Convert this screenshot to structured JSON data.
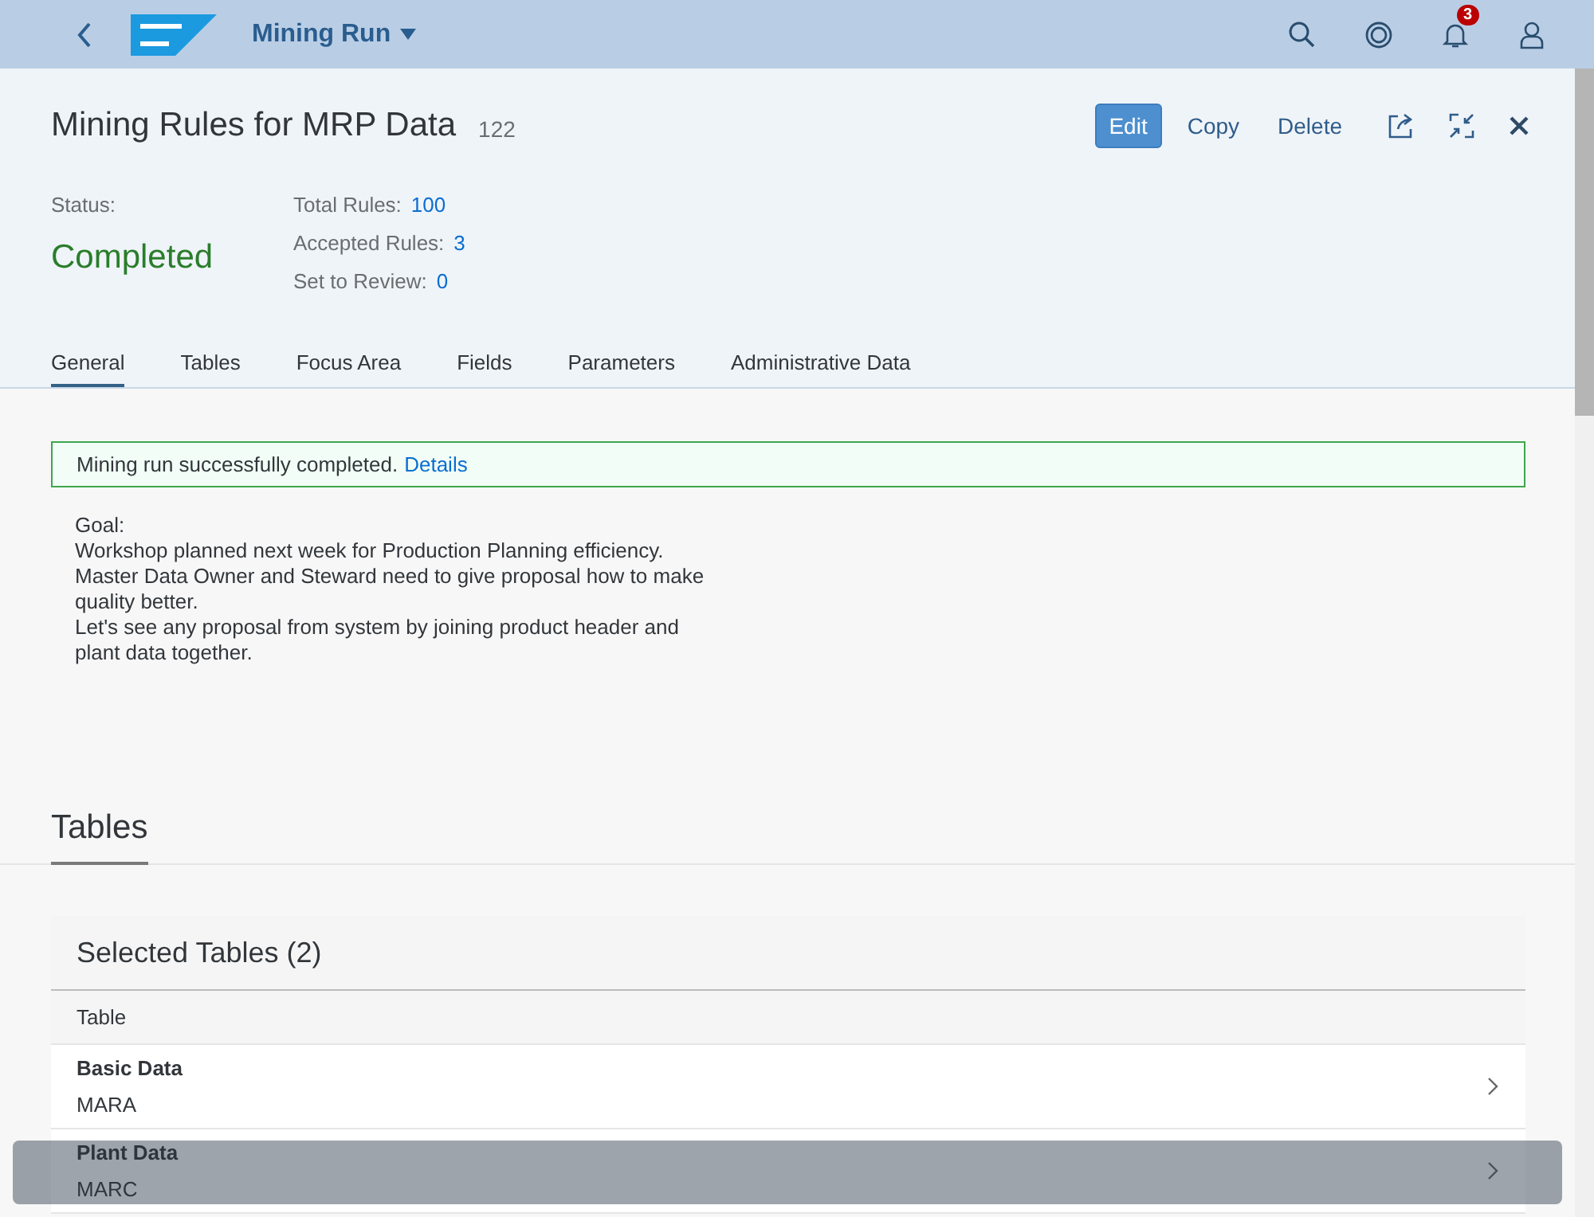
{
  "shell": {
    "app_title": "Mining Run",
    "notification_count": "3"
  },
  "header": {
    "title": "Mining Rules for MRP Data",
    "count": "122",
    "actions": [
      "Edit",
      "Copy",
      "Delete"
    ],
    "status_label": "Status:",
    "status_value": "Completed",
    "kpis": [
      {
        "label": "Total Rules:",
        "value": "100"
      },
      {
        "label": "Accepted Rules:",
        "value": "3"
      },
      {
        "label": "Set to Review:",
        "value": "0"
      }
    ]
  },
  "tabs": [
    {
      "label": "General",
      "selected": true
    },
    {
      "label": "Tables",
      "selected": false
    },
    {
      "label": "Focus Area",
      "selected": false
    },
    {
      "label": "Fields",
      "selected": false
    },
    {
      "label": "Parameters",
      "selected": false
    },
    {
      "label": "Administrative Data",
      "selected": false
    }
  ],
  "message": {
    "text": "Mining run successfully completed.",
    "link": "Details"
  },
  "goal": {
    "label": "Goal:",
    "lines": [
      "Workshop planned next week for Production Planning efficiency.",
      "Master Data Owner and Steward need to give proposal how to make quality better.",
      "Let's see any proposal from system by joining product header and plant data together."
    ]
  },
  "section_title": "Tables",
  "table": {
    "title": "Selected Tables (2)",
    "columns": [
      "Table"
    ],
    "rows": [
      {
        "name": "Basic Data",
        "code": "MARA"
      },
      {
        "name": "Plant Data",
        "code": "MARC"
      }
    ]
  }
}
